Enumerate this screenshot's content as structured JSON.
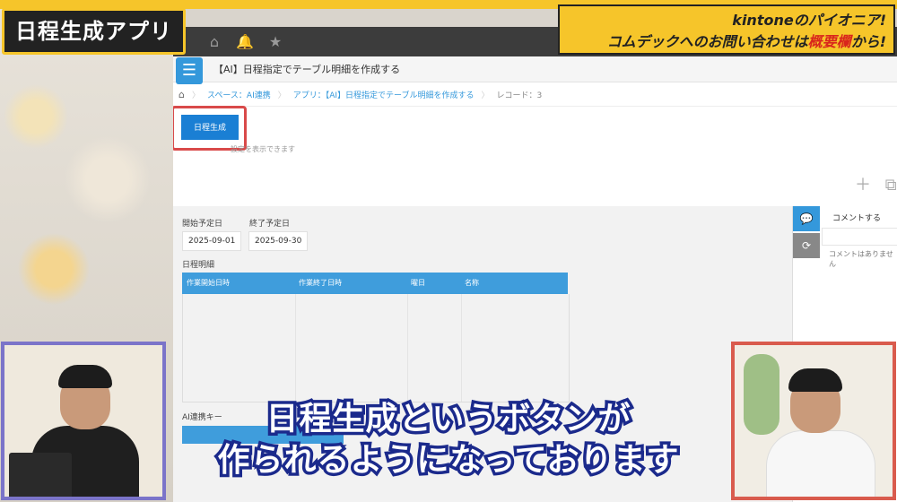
{
  "video": {
    "title_tag": "日程生成アプリ",
    "banner": {
      "line1": "kintoneのパイオニア!",
      "line2_prefix": "コムデックへのお問い合わせは",
      "line2_accent": "概要欄",
      "line2_suffix": "から!"
    },
    "subtitle": {
      "line1": "日程生成というボタンが",
      "line2": "作られるようになっております"
    }
  },
  "kintone": {
    "header_icons": [
      "home-icon",
      "bell-icon",
      "star-icon"
    ],
    "app_title": "【AI】日程指定でテーブル明細を作成する",
    "breadcrumb": {
      "space": "スペース：AI連携",
      "app": "アプリ：【AI】日程指定でテーブル明細を作成する",
      "record": "レコード：3"
    },
    "generate_button": "日程生成",
    "hint": "設定を表示できます",
    "fields": {
      "start_label": "開始予定日",
      "start_value": "2025-09-01",
      "end_label": "終了予定日",
      "end_value": "2025-09-30",
      "table_label": "日程明細",
      "table_headers": [
        "作業開始日時",
        "作業終了日時",
        "曜日",
        "名称"
      ],
      "ai_key_label": "AI連携キー"
    },
    "comments": {
      "label": "コメントする",
      "empty": "コメントはありません"
    }
  },
  "colors": {
    "kintone_blue": "#3498db",
    "highlight_red": "#d94a4a",
    "banner_yellow": "#f6c52a",
    "subtitle_stroke": "#1b2a8c"
  }
}
